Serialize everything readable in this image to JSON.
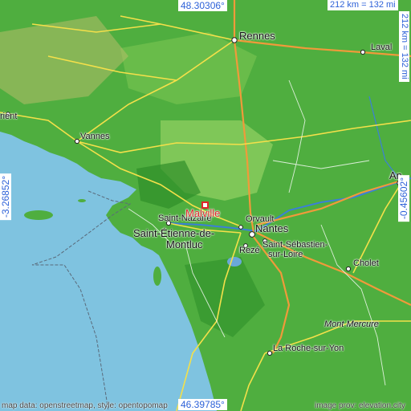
{
  "coordinates": {
    "top": "48.30306°",
    "bottom": "46.39785°",
    "left": "-3.26852°",
    "right": "-0.45602°"
  },
  "scale": {
    "horizontal": "212 km = 132 mi",
    "vertical": "212 km = 132 mi"
  },
  "places": {
    "rennes": "Rennes",
    "laval": "Laval",
    "lorient": "rient",
    "vannes": "Vannes",
    "angers": "An",
    "saint_nazaire": "Saint-Nazaire",
    "malville": "Malville",
    "saint_etienne_line1": "Saint-Étienne-de-",
    "saint_etienne_line2": "Montluc",
    "orvault": "Orvault",
    "nantes": "Nantes",
    "reze": "Rezé",
    "saint_sebastien_line1": "Saint-Sébastien-",
    "saint_sebastien_line2": "sur-Loire",
    "cholet": "Cholet",
    "mont_mercure": "Mont Mercure",
    "la_roche": "La Roche-sur-Yon"
  },
  "credits": {
    "left": "map data: openstreetmap, style: opentopomap",
    "right": "image prov: elevation.city"
  },
  "colors": {
    "sea": "#7fc3e0",
    "land_green": "#4fae3f",
    "marker": "#e0262a",
    "coord_text": "#2d61d8"
  }
}
